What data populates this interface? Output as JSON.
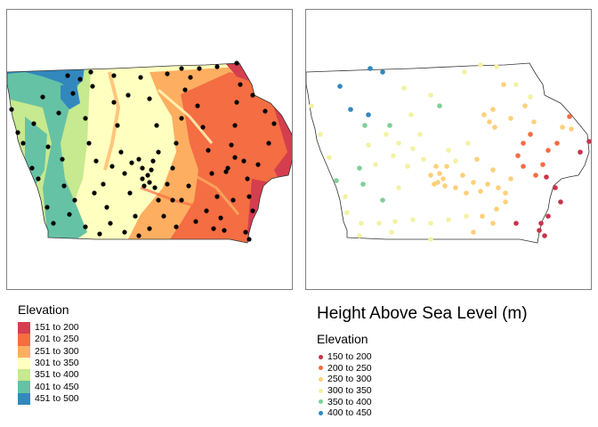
{
  "left_map": {
    "legend_title": "Elevation",
    "legend_items": [
      {
        "label": "151 to 200",
        "color": "#d53e4f"
      },
      {
        "label": "201 to 250",
        "color": "#f46d43"
      },
      {
        "label": "251 to 300",
        "color": "#fdae61"
      },
      {
        "label": "301 to 350",
        "color": "#ffffbf"
      },
      {
        "label": "351 to 400",
        "color": "#c7e98f"
      },
      {
        "label": "401 to 450",
        "color": "#66c2a5"
      },
      {
        "label": "451 to 500",
        "color": "#3288bd"
      }
    ],
    "point_color": "#000000"
  },
  "right_map": {
    "title": "Height Above Sea Level (m)",
    "legend_title": "Elevation",
    "legend_items": [
      {
        "label": "150 to 200",
        "color": "#c8344a"
      },
      {
        "label": "200 to 250",
        "color": "#f46d43"
      },
      {
        "label": "250 to 300",
        "color": "#fdd07a"
      },
      {
        "label": "300 to 350",
        "color": "#f2f2a4"
      },
      {
        "label": "350 to 400",
        "color": "#7fcf98"
      },
      {
        "label": "400 to 450",
        "color": "#3288bd"
      }
    ]
  }
}
